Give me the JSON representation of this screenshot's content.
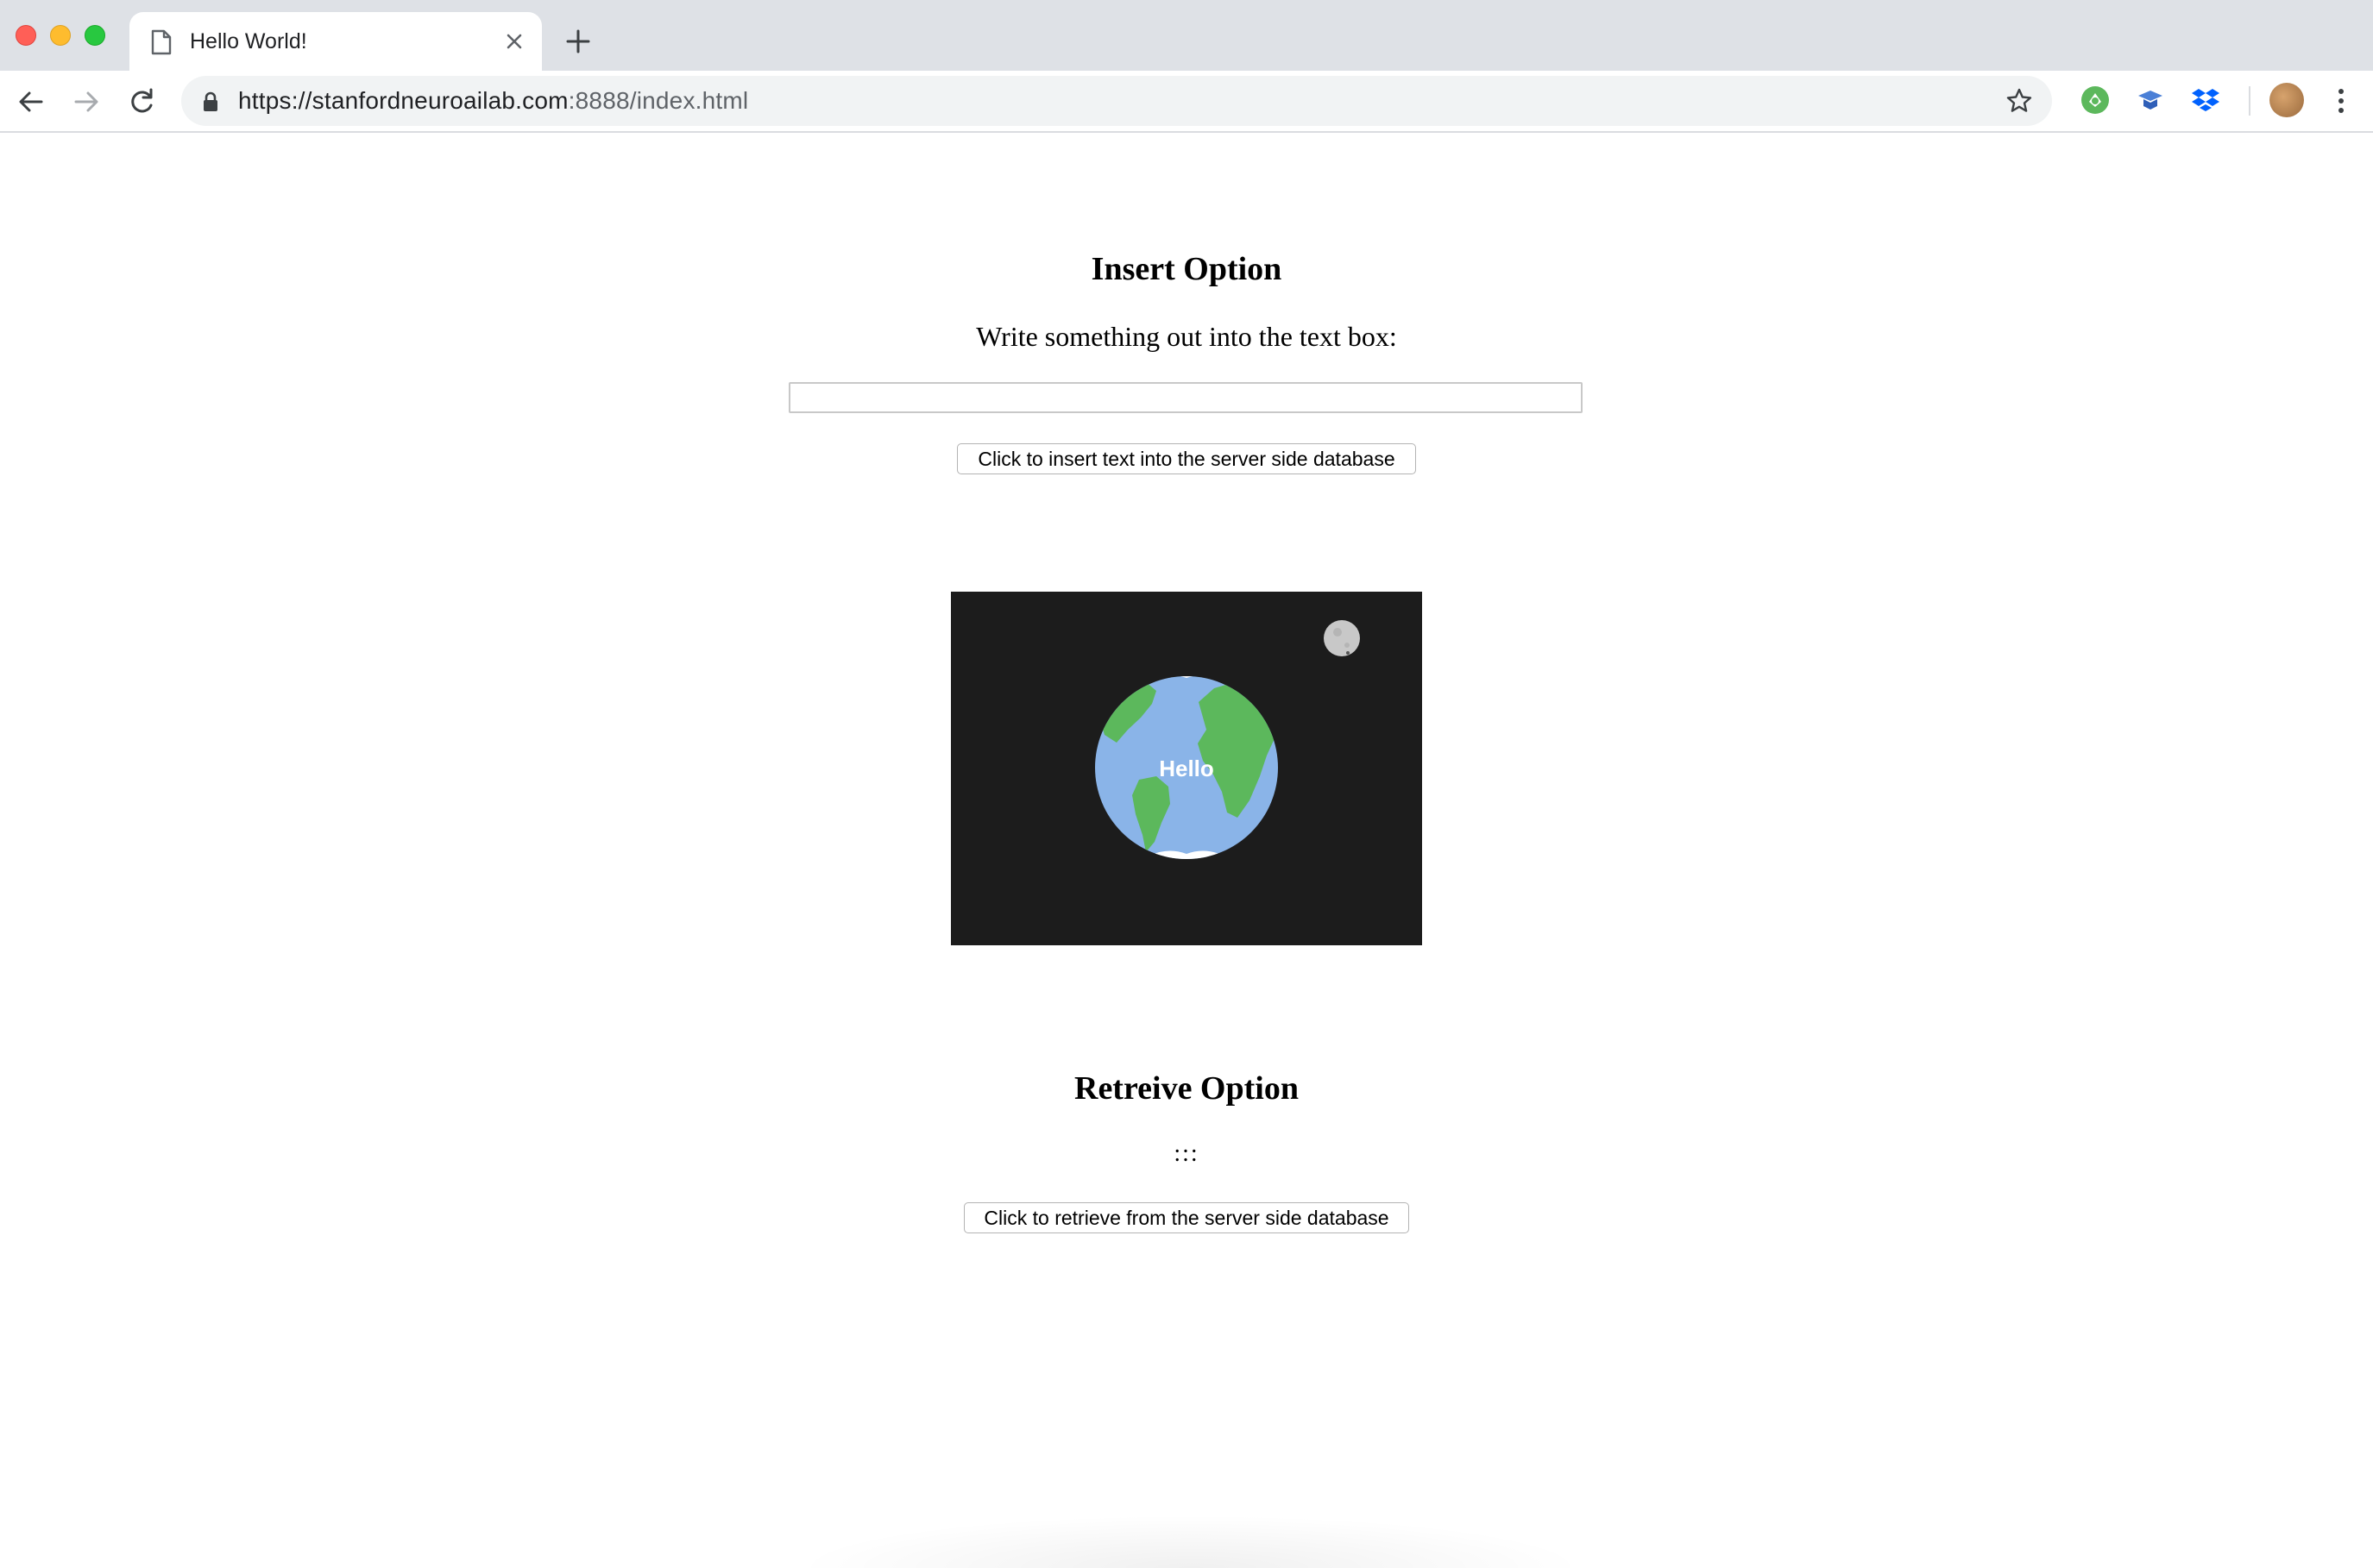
{
  "browser": {
    "tab": {
      "title": "Hello World!"
    },
    "address_bar": {
      "url_host": "https://stanfordneuroailab.com",
      "url_rest": ":8888/index.html"
    },
    "icons": {
      "page": "document-icon",
      "lock": "lock-icon",
      "star": "star-icon",
      "extensions": [
        "green-extension-icon",
        "blue-extension-icon",
        "dropbox-icon"
      ]
    }
  },
  "page": {
    "insert": {
      "heading": "Insert Option",
      "prompt": "Write something out into the text box:",
      "input_value": "",
      "button_label": "Click to insert text into the server side database"
    },
    "animation": {
      "globe_label": "Hello",
      "colors": {
        "space": "#1c1c1c",
        "ocean": "#8ab4e8",
        "land": "#5cb85c",
        "moon": "#c8c8c8"
      }
    },
    "retrieve": {
      "heading": "Retreive Option",
      "result": ":::",
      "button_label": "Click to retrieve from the server side database"
    }
  }
}
